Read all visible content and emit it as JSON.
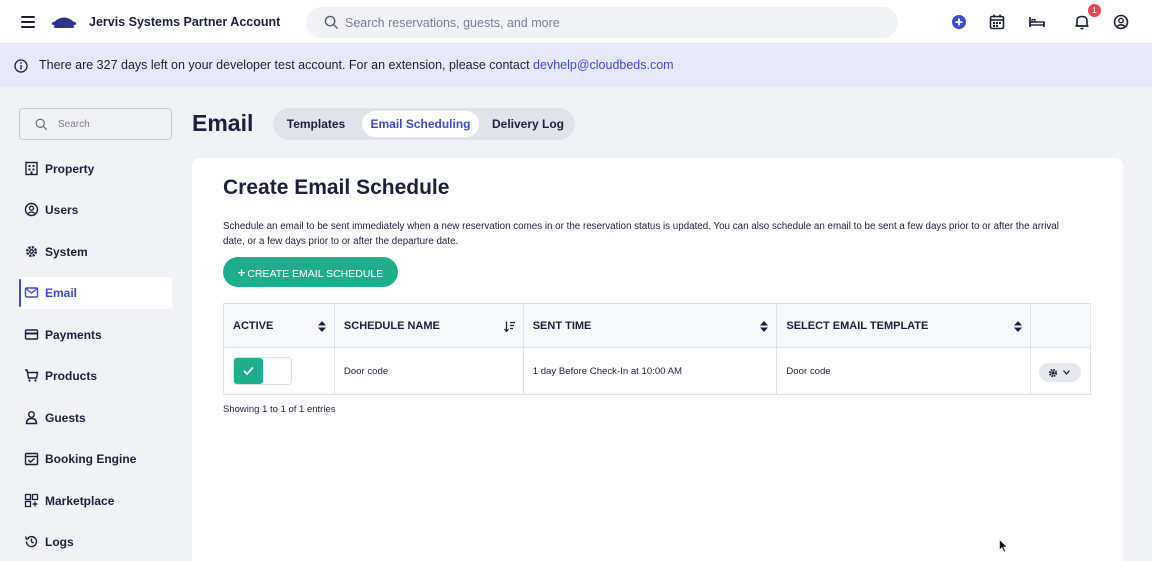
{
  "topbar": {
    "account_name": "Jervis Systems Partner Account",
    "search_placeholder": "Search reservations, guests, and more",
    "notification_count": "1"
  },
  "banner": {
    "text": "There are 327 days left on your developer test account. For an extension, please contact ",
    "link": "devhelp@cloudbeds.com"
  },
  "sidebar": {
    "search_placeholder": "Search",
    "items": [
      {
        "label": "Property",
        "icon": "building-icon"
      },
      {
        "label": "Users",
        "icon": "user-circle-icon"
      },
      {
        "label": "System",
        "icon": "gear-icon"
      },
      {
        "label": "Email",
        "icon": "envelope-icon",
        "active": true
      },
      {
        "label": "Payments",
        "icon": "credit-card-icon"
      },
      {
        "label": "Products",
        "icon": "cart-icon"
      },
      {
        "label": "Guests",
        "icon": "person-icon"
      },
      {
        "label": "Booking Engine",
        "icon": "calendar-check-icon"
      },
      {
        "label": "Marketplace",
        "icon": "apps-icon"
      },
      {
        "label": "Logs",
        "icon": "history-icon"
      }
    ]
  },
  "page": {
    "title": "Email",
    "tabs": [
      {
        "label": "Templates"
      },
      {
        "label": "Email Scheduling",
        "active": true
      },
      {
        "label": "Delivery Log"
      }
    ]
  },
  "card": {
    "title": "Create Email Schedule",
    "description": "Schedule an email to be sent immediately when a new reservation comes in or the reservation status is updated. You can also schedule an email to be sent a few days prior to or after the arrival date, or a few days prior to or after the departure date.",
    "create_button": "CREATE EMAIL SCHEDULE"
  },
  "table": {
    "headers": [
      "ACTIVE",
      "SCHEDULE NAME",
      "SENT TIME",
      "SELECT EMAIL TEMPLATE",
      ""
    ],
    "rows": [
      {
        "active": true,
        "schedule_name": "Door code",
        "sent_time": "1 day Before Check-In at 10:00 AM",
        "template": "Door code"
      }
    ],
    "entries_text": "Showing 1 to 1 of 1 entries"
  },
  "colors": {
    "accent": "#3b4bd8",
    "success": "#1fae8b",
    "banner_bg": "#e7e9fb",
    "badge": "#e5484d"
  }
}
